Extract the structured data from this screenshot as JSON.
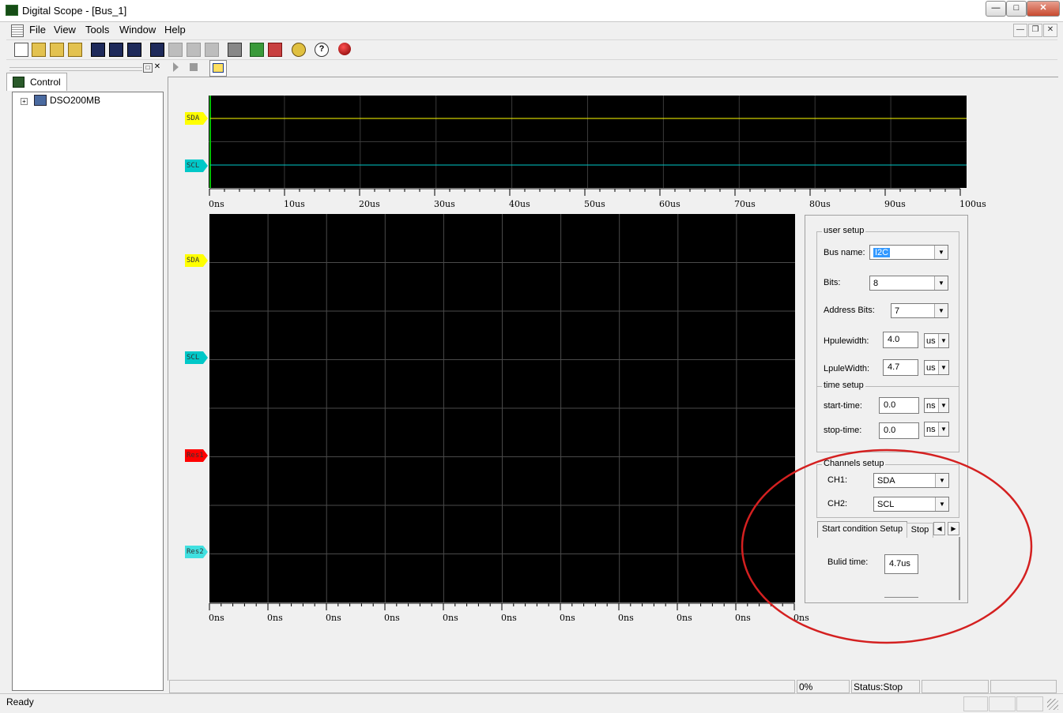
{
  "window": {
    "title": "Digital Scope - [Bus_1]"
  },
  "menu": [
    "File",
    "View",
    "Tools",
    "Window",
    "Help"
  ],
  "left_panel": {
    "tab": "Control",
    "tree_root": "DSO200MB"
  },
  "overview": {
    "channels": [
      "SDA",
      "SCL"
    ],
    "time_ticks": [
      "0ns",
      "10us",
      "20us",
      "30us",
      "40us",
      "50us",
      "60us",
      "70us",
      "80us",
      "90us",
      "100us"
    ]
  },
  "detail": {
    "channels": [
      "SDA",
      "SCL",
      "Res1",
      "Res2"
    ],
    "time_ticks": [
      "0ns",
      "0ns",
      "0ns",
      "0ns",
      "0ns",
      "0ns",
      "0ns",
      "0ns",
      "0ns",
      "0ns",
      "0ns"
    ]
  },
  "colors": {
    "sda": "#ffff00",
    "scl": "#00c8c8",
    "res1": "#ff0000",
    "res2": "#40e0e0",
    "annotation": "#d42020"
  },
  "setup": {
    "user_setup": {
      "title": "user setup",
      "bus_name_label": "Bus name:",
      "bus_name": "I2C",
      "bits_label": "Bits:",
      "bits": "8",
      "address_bits_label": "Address Bits:",
      "address_bits": "7",
      "hpulse_label": "Hpulewidth:",
      "hpulse": "4.0",
      "hpulse_unit": "us",
      "lpulse_label": "LpuleWidth:",
      "lpulse": "4.7",
      "lpulse_unit": "us"
    },
    "time_setup": {
      "title": "time setup",
      "start_label": "start-time:",
      "start": "0.0",
      "start_unit": "ns",
      "stop_label": "stop-time:",
      "stop": "0.0",
      "stop_unit": "ns"
    },
    "channels_setup": {
      "title": "Channels setup",
      "ch1_label": "CH1:",
      "ch1": "SDA",
      "ch2_label": "CH2:",
      "ch2": "SCL"
    },
    "tabs": [
      "Start condition Setup",
      "Stop"
    ],
    "build_time_label": "Bulid time:",
    "build_time": "4.7us"
  },
  "inner_status": {
    "progress": "0%",
    "status": "Status:Stop"
  },
  "status": {
    "text": "Ready"
  }
}
